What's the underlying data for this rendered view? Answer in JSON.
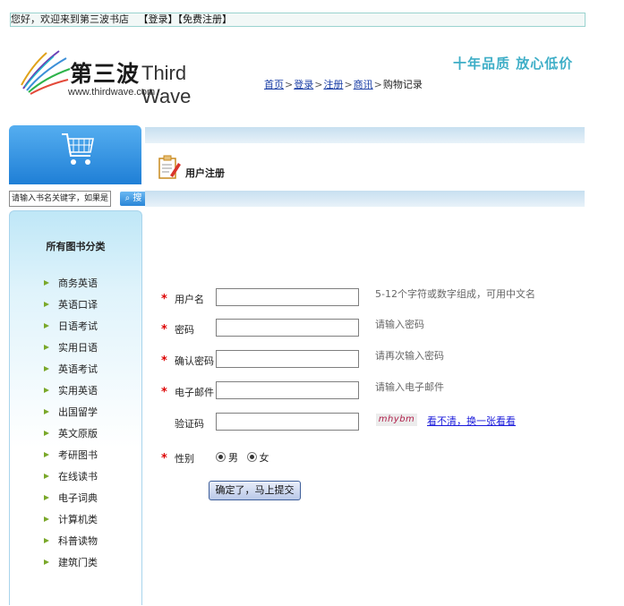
{
  "topbar": {
    "welcome": "您好，欢迎来到第三波书店",
    "login": "【登录】",
    "register": "【免费注册】"
  },
  "logo": {
    "cn": "第三波",
    "en": "Third Wave",
    "url": "www.thirdwave.com"
  },
  "slogan": "十年品质  放心低价",
  "nav": {
    "items": [
      "首页",
      "登录",
      "注册",
      "商讯"
    ],
    "last": "购物记录",
    "sep": ">"
  },
  "search": {
    "placeholder": "请输入书名关键字，如果是",
    "button": "搜"
  },
  "categories": {
    "title": "所有图书分类",
    "items": [
      "商务英语",
      "英语口译",
      "日语考试",
      "实用日语",
      "英语考试",
      "实用英语",
      "出国留学",
      "英文原版",
      "考研图书",
      "在线读书",
      "电子词典",
      "计算机类",
      "科普读物",
      "建筑门类"
    ]
  },
  "register": {
    "title": "用户注册",
    "fields": [
      {
        "label": "用户名",
        "required": "*",
        "hint": "5-12个字符或数字组成，可用中文名"
      },
      {
        "label": "密码",
        "required": "*",
        "hint": "请输入密码"
      },
      {
        "label": "确认密码",
        "required": "*",
        "hint": "请再次输入密码"
      },
      {
        "label": "电子邮件",
        "required": "*",
        "hint": "请输入电子邮件"
      }
    ],
    "captcha": {
      "label": "验证码",
      "image_text": "mhybm",
      "refresh_link": "看不清，换一张看看"
    },
    "gender": {
      "label": "性别",
      "required": "*",
      "options": [
        "男",
        "女"
      ]
    },
    "submit": "确定了，马上提交"
  },
  "colors": {
    "accent": "#3eaec7",
    "link": "#1b3fa6",
    "required": "#dd0000"
  }
}
